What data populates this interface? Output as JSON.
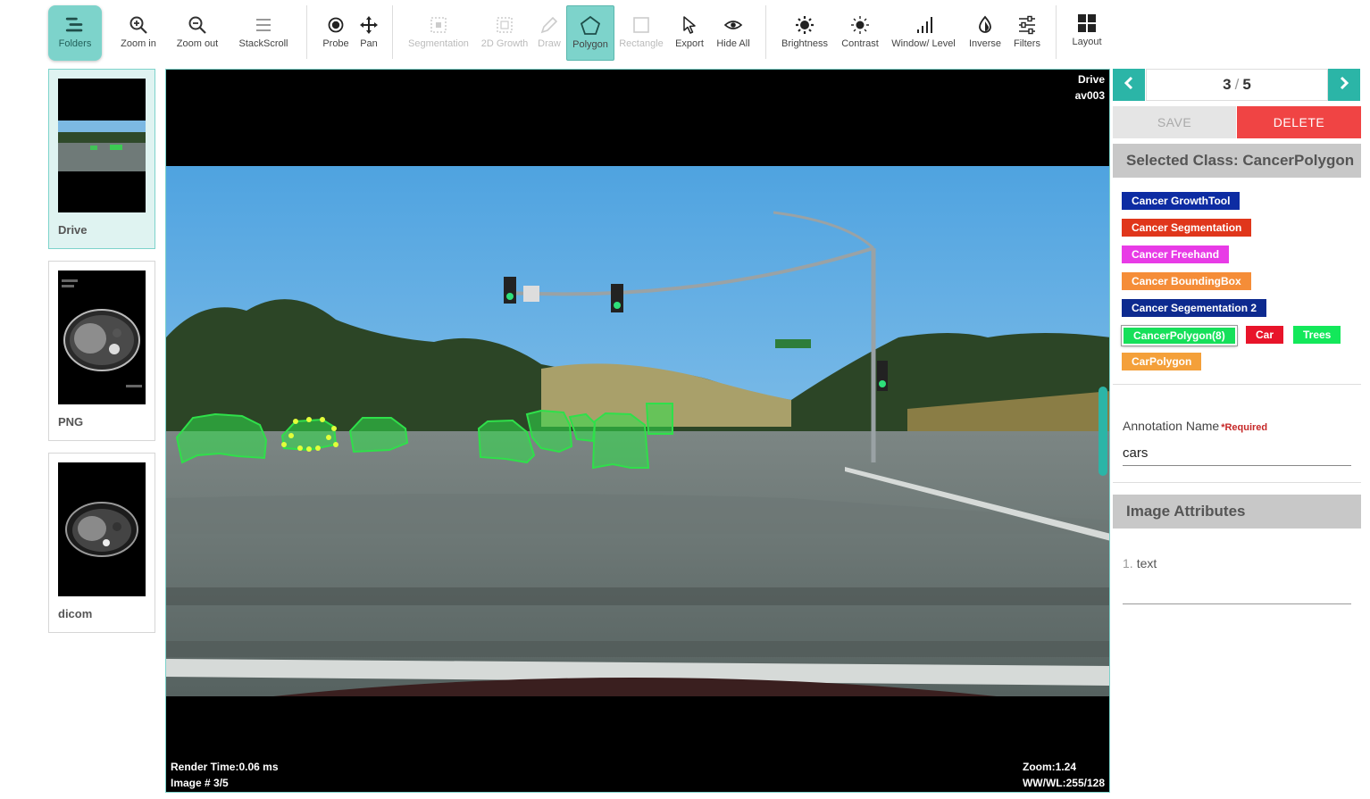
{
  "toolbar": {
    "tools": [
      {
        "id": "folders",
        "label": "Folders",
        "icon": "folders-icon"
      },
      {
        "id": "zoom-in",
        "label": "Zoom in",
        "icon": "zoom-in-icon"
      },
      {
        "id": "zoom-out",
        "label": "Zoom out",
        "icon": "zoom-out-icon"
      },
      {
        "id": "stackscroll",
        "label": "StackScroll",
        "icon": "stackscroll-icon"
      },
      {
        "id": "probe",
        "label": "Probe",
        "icon": "probe-icon"
      },
      {
        "id": "pan",
        "label": "Pan",
        "icon": "pan-icon"
      },
      {
        "id": "segmentation",
        "label": "Segmentation",
        "icon": "segmentation-icon",
        "disabled": true
      },
      {
        "id": "growth-2d",
        "label": "2D Growth",
        "icon": "growth-icon",
        "disabled": true
      },
      {
        "id": "draw",
        "label": "Draw",
        "icon": "pencil-icon",
        "disabled": true
      },
      {
        "id": "polygon",
        "label": "Polygon",
        "icon": "polygon-icon",
        "active": true
      },
      {
        "id": "rectangle",
        "label": "Rectangle",
        "icon": "rectangle-icon",
        "disabled": true
      },
      {
        "id": "export",
        "label": "Export",
        "icon": "cursor-icon"
      },
      {
        "id": "hide-all",
        "label": "Hide All",
        "icon": "eye-icon"
      },
      {
        "id": "brightness",
        "label": "Brightness",
        "icon": "brightness-icon"
      },
      {
        "id": "contrast",
        "label": "Contrast",
        "icon": "contrast-icon"
      },
      {
        "id": "window-level",
        "label": "Window/ Level",
        "icon": "signal-icon"
      },
      {
        "id": "inverse",
        "label": "Inverse",
        "icon": "inverse-icon"
      },
      {
        "id": "filters",
        "label": "Filters",
        "icon": "sliders-icon"
      },
      {
        "id": "layout",
        "label": "Layout",
        "icon": "grid-icon"
      }
    ]
  },
  "thumbnails": [
    {
      "label": "Drive",
      "selected": true
    },
    {
      "label": "PNG",
      "selected": false
    },
    {
      "label": "dicom",
      "selected": false
    }
  ],
  "viewport": {
    "top_right_line1": "Drive",
    "top_right_line2": "av003",
    "render_time": "Render Time:0.06 ms",
    "image_index": "Image # 3/5",
    "zoom": "Zoom:1.24",
    "wwwl": "WW/WL:255/128"
  },
  "pager": {
    "current": "3",
    "separator": "/",
    "total": "5"
  },
  "actions": {
    "save": "SAVE",
    "delete": "DELETE"
  },
  "selected_class": {
    "heading": "Selected Class: CancerPolygon"
  },
  "classes": [
    {
      "label": "Cancer GrowthTool",
      "color": "#0d2ca3"
    },
    {
      "label": "Cancer Segmentation",
      "color": "#e0361b"
    },
    {
      "label": "Cancer Freehand",
      "color": "#e83be6"
    },
    {
      "label": "Cancer BoundingBox",
      "color": "#f58d38"
    },
    {
      "label": "Cancer Segementation 2",
      "color": "#0d2a8f"
    },
    {
      "label": "CancerPolygon(8)",
      "color": "#16e05a",
      "selected": true
    },
    {
      "label": "Car",
      "color": "#e8142a"
    },
    {
      "label": "Trees",
      "color": "#13e85a"
    },
    {
      "label": "CarPolygon",
      "color": "#f4a03a"
    }
  ],
  "annotation": {
    "label": "Annotation Name",
    "required": "*Required",
    "value": "cars"
  },
  "image_attributes": {
    "heading": "Image Attributes",
    "items": [
      {
        "num": "1.",
        "text": "text"
      }
    ]
  },
  "colors": {
    "accent": "#2bb5a7",
    "active_tool": "#7dd3cb",
    "delete": "#f04444",
    "annotation": "#2fe04a"
  }
}
